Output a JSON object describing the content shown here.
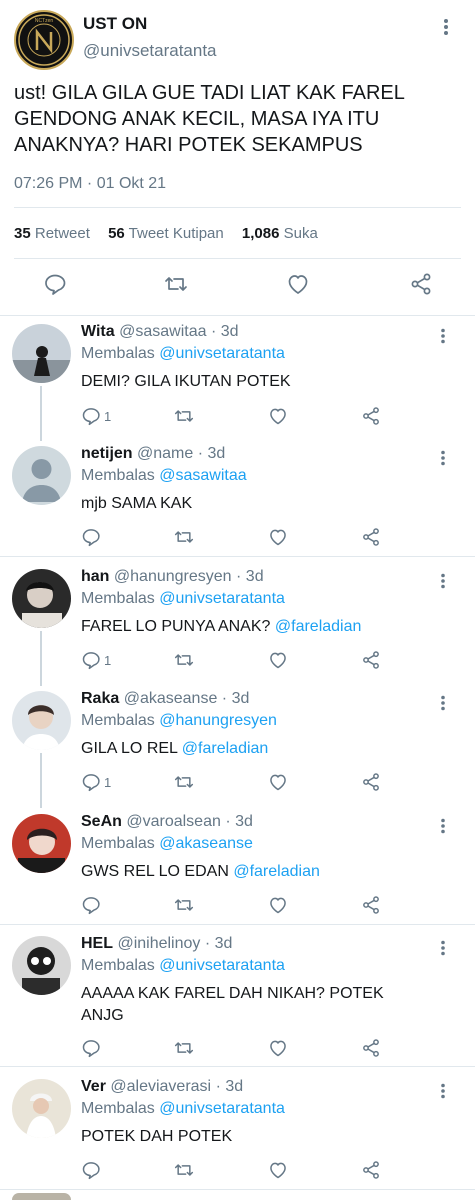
{
  "main_tweet": {
    "name": "UST ON",
    "handle": "@univsetaratanta",
    "avatar_text": "NCTzen",
    "text": "ust! GILA GILA GUE TADI LIAT KAK FAREL GENDONG ANAK KECIL, MASA IYA ITU ANAKNYA? HARI POTEK SEKAMPUS",
    "timestamp": "07:26 PM · 01 Okt 21",
    "stats": {
      "retweets_count": "35",
      "retweets_label": "Retweet",
      "quotes_count": "56",
      "quotes_label": "Tweet Kutipan",
      "likes_count": "1,086",
      "likes_label": "Suka"
    }
  },
  "replying_label": "Membalas",
  "replies": [
    {
      "name": "Wita",
      "handle": "@sasawitaa",
      "time": "· 3d",
      "replying_to": "@univsetaratanta",
      "text": "DEMI? GILA IKUTAN POTEK",
      "mention": "",
      "reply_count": "1"
    },
    {
      "name": "netijen",
      "handle": "@name",
      "time": "· 3d",
      "replying_to": "@sasawitaa",
      "text": "mjb SAMA KAK",
      "mention": "",
      "reply_count": ""
    },
    {
      "name": "han",
      "handle": "@hanungresyen",
      "time": "· 3d",
      "replying_to": "@univsetaratanta",
      "text": "FAREL LO PUNYA ANAK?",
      "mention": "@fareladian",
      "reply_count": "1"
    },
    {
      "name": "Raka",
      "handle": "@akaseanse",
      "time": "· 3d",
      "replying_to": "@hanungresyen",
      "text": "GILA LO REL",
      "mention": "@fareladian",
      "reply_count": "1"
    },
    {
      "name": "SeAn",
      "handle": "@varoalsean",
      "time": "· 3d",
      "replying_to": "@akaseanse",
      "text": "GWS REL LO EDAN",
      "mention": "@fareladian",
      "reply_count": ""
    },
    {
      "name": "HEL",
      "handle": "@inihelinoy",
      "time": "· 3d",
      "replying_to": "@univsetaratanta",
      "text": "AAAAA KAK FAREL DAH NIKAH? POTEK ANJG",
      "mention": "",
      "reply_count": ""
    },
    {
      "name": "Ver",
      "handle": "@aleviaverasi",
      "time": "· 3d",
      "replying_to": "@univsetaratanta",
      "text": "POTEK DAH POTEK",
      "mention": "",
      "reply_count": ""
    }
  ],
  "colors": {
    "link": "#1da1f2",
    "secondary_text": "#657786",
    "divider": "#e1e8ed",
    "icon": "#657786"
  }
}
